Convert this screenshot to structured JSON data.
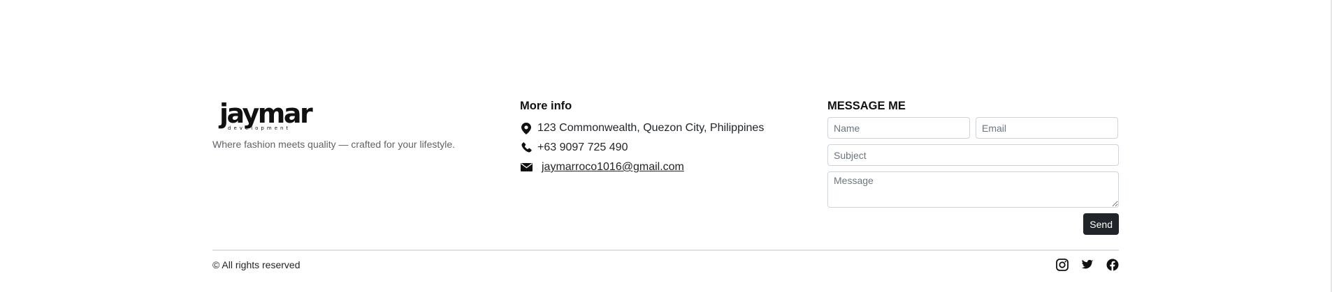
{
  "brand": {
    "logo_text": "jaymar",
    "logo_subtext": "development",
    "tagline": "Where fashion meets quality — crafted for your lifestyle."
  },
  "info": {
    "title": "More info",
    "address": "123 Commonwealth, Quezon City, Philippines",
    "phone": "+63 9097 725 490",
    "email": "jaymarroco1016@gmail.com",
    "icons": [
      "location-pin-icon",
      "phone-icon",
      "envelope-icon"
    ]
  },
  "form": {
    "title": "MESSAGE ME",
    "name_placeholder": "Name",
    "email_placeholder": "Email",
    "subject_placeholder": "Subject",
    "message_placeholder": "Message",
    "send_label": "Send"
  },
  "footer": {
    "copyright": "© All rights reserved",
    "social_icons": [
      "instagram-icon",
      "twitter-icon",
      "facebook-icon"
    ]
  },
  "colors": {
    "button_bg": "#212529",
    "text": "#212529",
    "muted": "#5f6368",
    "divider": "#dee2e6"
  }
}
